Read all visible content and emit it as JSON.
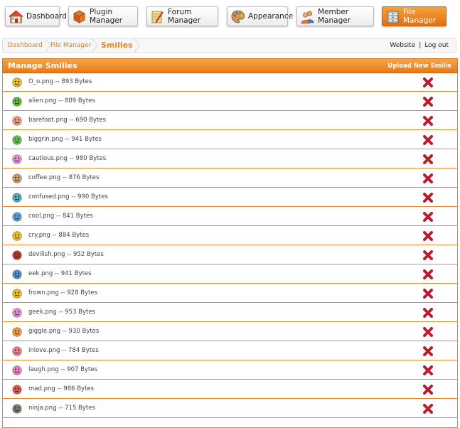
{
  "nav": {
    "buttons": [
      {
        "id": "dashboard",
        "label": "Dashboard",
        "icon": "house-icon",
        "active": false
      },
      {
        "id": "plugin-manager",
        "label": "Plugin Manager",
        "icon": "boxes-icon",
        "active": false
      },
      {
        "id": "forum-manager",
        "label": "Forum Manager",
        "icon": "notepad-pencil-icon",
        "active": false
      },
      {
        "id": "appearance",
        "label": "Appearance",
        "icon": "palette-icon",
        "active": false
      },
      {
        "id": "member-manager",
        "label": "Member Manager",
        "icon": "members-icon",
        "active": false
      },
      {
        "id": "file-manager",
        "label": "File Manager",
        "icon": "file-cabinet-icon",
        "active": true
      }
    ]
  },
  "breadcrumb": {
    "items": [
      "Dashboard",
      "File Manager"
    ],
    "current": "Smilies"
  },
  "toplinks": {
    "website": "Website",
    "separator": "|",
    "logout": "Log out"
  },
  "panel": {
    "title": "Manage Smilies",
    "upload_label": "Upload New Smilie"
  },
  "colors": {
    "accent": "#e8791a",
    "border": "#e48a2e",
    "delete": "#b81c2c"
  },
  "smilies": [
    {
      "label": "O_o.png -- 893 Bytes",
      "color": "#f2c21b"
    },
    {
      "label": "alien.png -- 809 Bytes",
      "color": "#5dbb3a"
    },
    {
      "label": "barefoot.png -- 690 Bytes",
      "color": "#f39a7c"
    },
    {
      "label": "biggrin.png -- 941 Bytes",
      "color": "#5dc25a"
    },
    {
      "label": "cautious.png -- 980 Bytes",
      "color": "#e58be0"
    },
    {
      "label": "coffee.png -- 876 Bytes",
      "color": "#c9a07a"
    },
    {
      "label": "confused.png -- 990 Bytes",
      "color": "#46b7c9"
    },
    {
      "label": "cool.png -- 841 Bytes",
      "color": "#5b9fe0"
    },
    {
      "label": "cry.png -- 884 Bytes",
      "color": "#f2c21b"
    },
    {
      "label": "devilish.png -- 952 Bytes",
      "color": "#b8332a"
    },
    {
      "label": "eek.png -- 941 Bytes",
      "color": "#4a8fe0"
    },
    {
      "label": "frown.png -- 928 Bytes",
      "color": "#f2c21b"
    },
    {
      "label": "geek.png -- 953 Bytes",
      "color": "#e58be0"
    },
    {
      "label": "giggle.png -- 930 Bytes",
      "color": "#f39a3c"
    },
    {
      "label": "inlove.png -- 784 Bytes",
      "color": "#f07a8c"
    },
    {
      "label": "laugh.png -- 907 Bytes",
      "color": "#ef7fbf"
    },
    {
      "label": "mad.png -- 986 Bytes",
      "color": "#e8584a"
    },
    {
      "label": "ninja.png -- 715 Bytes",
      "color": "#7a7a7a"
    }
  ]
}
